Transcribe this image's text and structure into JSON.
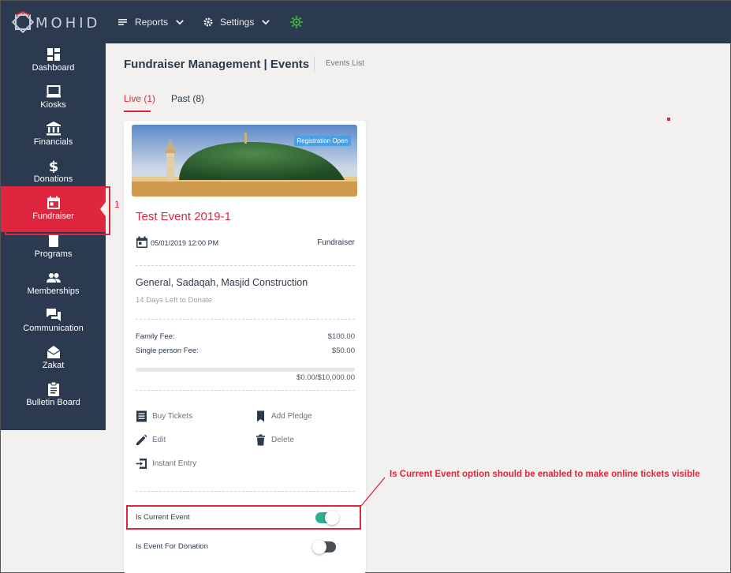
{
  "brand": {
    "name": "MOHID"
  },
  "topnav": {
    "reports_label": "Reports",
    "settings_label": "Settings"
  },
  "sidebar": {
    "items": [
      {
        "label": "Dashboard",
        "icon": "dashboard-icon"
      },
      {
        "label": "Kiosks",
        "icon": "kiosk-icon"
      },
      {
        "label": "Financials",
        "icon": "bank-icon"
      },
      {
        "label": "Donations",
        "icon": "dollar-icon"
      },
      {
        "label": "Fundraiser",
        "icon": "calendar-icon",
        "active": true
      },
      {
        "label": "Programs",
        "icon": "book-icon"
      },
      {
        "label": "Memberships",
        "icon": "people-icon"
      },
      {
        "label": "Communication",
        "icon": "chat-icon"
      },
      {
        "label": "Zakat",
        "icon": "envelope-icon"
      },
      {
        "label": "Bulletin Board",
        "icon": "clipboard-icon"
      }
    ]
  },
  "header": {
    "title": "Fundraiser Management | Events",
    "breadcrumb": "Events List"
  },
  "tabs": [
    {
      "label": "Live (1)",
      "active": true
    },
    {
      "label": "Past (8)",
      "active": false
    }
  ],
  "event": {
    "badge": "Registration Open",
    "title": "Test Event 2019-1",
    "datetime": "05/01/2019 12:00 PM",
    "type": "Fundraiser",
    "purposes": "General, Sadaqah, Masjid Construction",
    "days_left": "14 Days Left to Donate",
    "fees": [
      {
        "label": "Family Fee:",
        "value": "$100.00"
      },
      {
        "label": "Single person Fee:",
        "value": "$50.00"
      }
    ],
    "progress": {
      "fraction": 0.0,
      "text": "$0.00/$10,000.00"
    },
    "actions": {
      "buy_tickets": "Buy Tickets",
      "add_pledge": "Add Pledge",
      "edit": "Edit",
      "delete": "Delete",
      "instant_entry": "Instant Entry"
    },
    "toggles": {
      "current_event": {
        "label": "Is Current Event",
        "on": true
      },
      "donation_event": {
        "label": "Is Event For Donation",
        "on": false
      }
    }
  },
  "annotations": {
    "step_number": "1",
    "note": "Is Current Event option should be enabled to make online tickets visible"
  },
  "colors": {
    "navy": "#2b3a4e",
    "accent": "#e0263f",
    "toggle_on": "#2fb08e",
    "badge": "#4aa0e6"
  }
}
